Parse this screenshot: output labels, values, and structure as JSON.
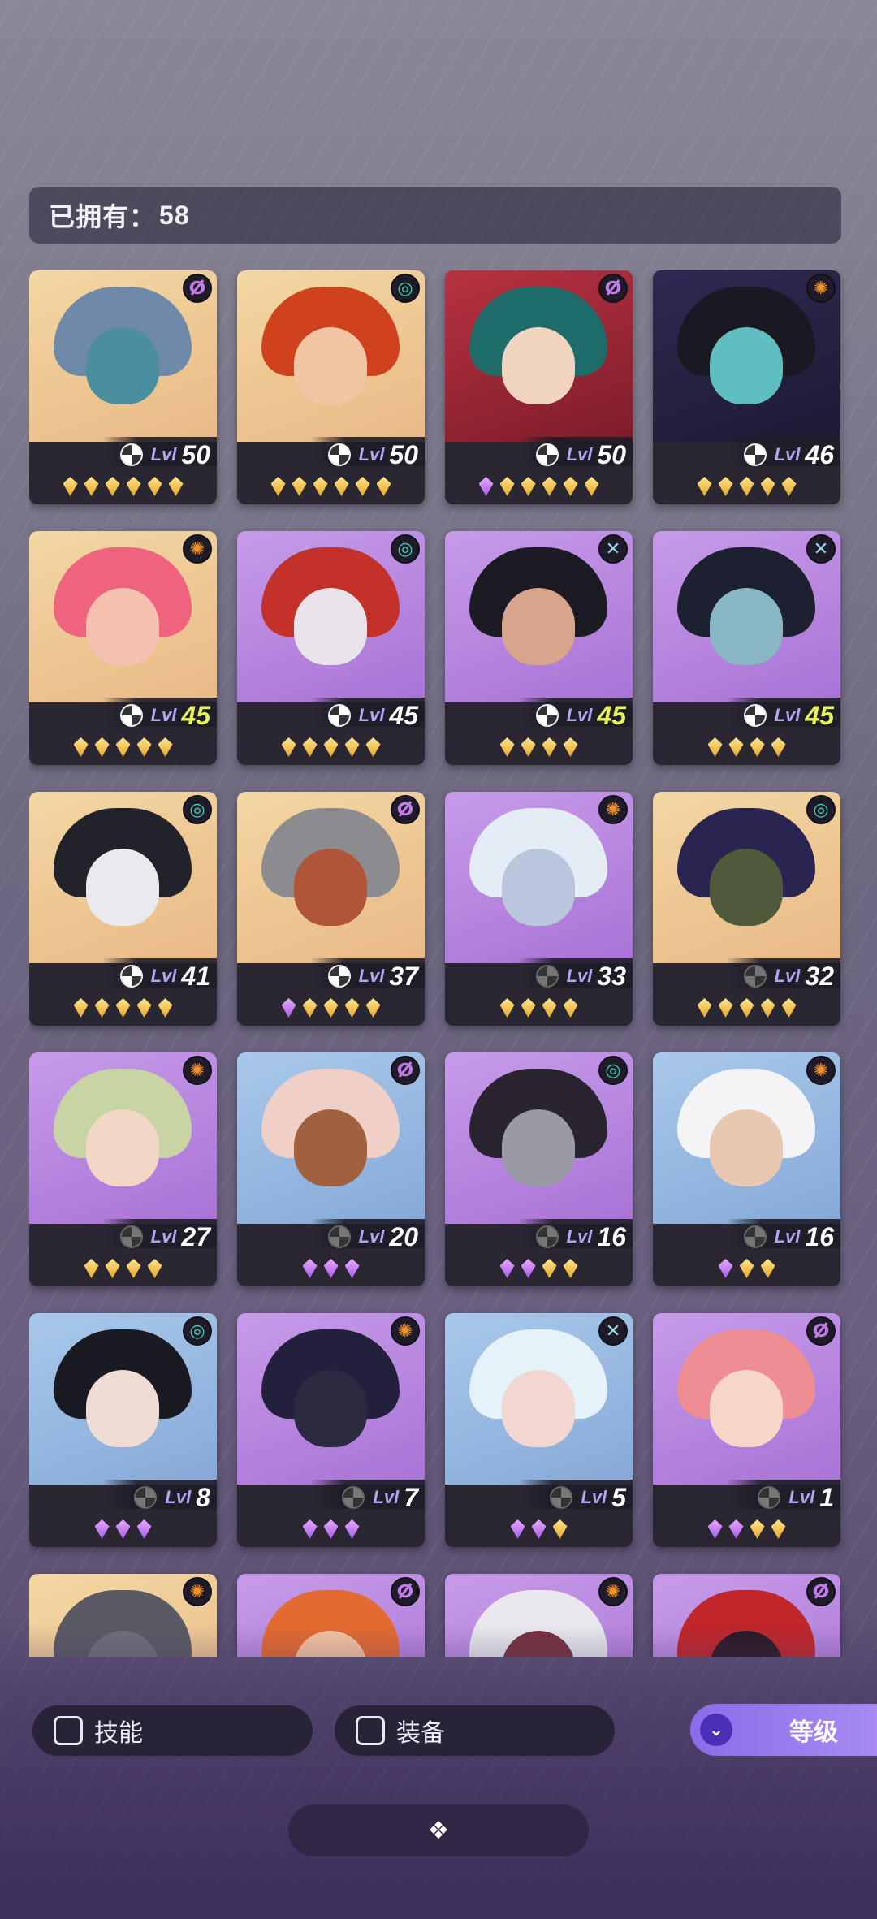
{
  "owned": {
    "label": "已拥有：",
    "count": "58"
  },
  "heroes": [
    {
      "type": "purple-spiral",
      "type_color": "purple",
      "bg": "gold",
      "hair": "#6f8aa8",
      "face": "#4a8ea0",
      "level": "50",
      "level_color": "white",
      "gems": [
        "gold",
        "gold",
        "gold",
        "gold",
        "gold",
        "gold"
      ]
    },
    {
      "type": "green-swirl",
      "type_color": "green",
      "bg": "gold",
      "hair": "#d0421e",
      "face": "#f2c6a4",
      "level": "50",
      "level_color": "white",
      "gems": [
        "gold",
        "gold",
        "gold",
        "gold",
        "gold",
        "gold"
      ]
    },
    {
      "type": "purple-spiral",
      "type_color": "purple",
      "bg": "red",
      "hair": "#1f6d6b",
      "face": "#f0d4c0",
      "level": "50",
      "level_color": "white",
      "gems": [
        "purple",
        "gold",
        "gold",
        "gold",
        "gold",
        "gold"
      ]
    },
    {
      "type": "orange-sun",
      "type_color": "orange",
      "bg": "dark",
      "hair": "#1a1820",
      "face": "#5fbfc0",
      "level": "46",
      "level_color": "white",
      "gems": [
        "gold",
        "gold",
        "gold",
        "gold",
        "gold"
      ]
    },
    {
      "type": "orange-sun",
      "type_color": "orange",
      "bg": "gold",
      "hair": "#f0637e",
      "face": "#f6c2b0",
      "level": "45",
      "level_color": "yellow",
      "gems": [
        "gold",
        "gold",
        "gold",
        "gold",
        "gold"
      ]
    },
    {
      "type": "green-swirl",
      "type_color": "green",
      "bg": "purple",
      "hair": "#c4302a",
      "face": "#e8e4ea",
      "level": "45",
      "level_color": "white",
      "gems": [
        "gold",
        "gold",
        "gold",
        "gold",
        "gold"
      ]
    },
    {
      "type": "teal-cross",
      "type_color": "teal",
      "bg": "purple",
      "hair": "#1c1a22",
      "face": "#d7a58c",
      "level": "45",
      "level_color": "yellow",
      "gems": [
        "gold",
        "gold",
        "gold",
        "gold"
      ]
    },
    {
      "type": "teal-cross",
      "type_color": "teal",
      "bg": "purple",
      "hair": "#1c2030",
      "face": "#8ab7c4",
      "level": "45",
      "level_color": "yellow",
      "gems": [
        "gold",
        "gold",
        "gold",
        "gold"
      ]
    },
    {
      "type": "green-swirl",
      "type_color": "green",
      "bg": "gold",
      "hair": "#22222a",
      "face": "#e9e9ee",
      "level": "41",
      "level_color": "white",
      "gems": [
        "gold",
        "gold",
        "gold",
        "gold",
        "gold"
      ]
    },
    {
      "type": "purple-spiral",
      "type_color": "purple",
      "bg": "gold",
      "hair": "#8c8c90",
      "face": "#b0553a",
      "level": "37",
      "level_color": "white",
      "gems": [
        "purple",
        "gold",
        "gold",
        "gold",
        "gold"
      ]
    },
    {
      "type": "orange-sun",
      "type_color": "orange",
      "bg": "purple",
      "hair": "#e4ecf5",
      "face": "#b9c6dc",
      "level": "33",
      "level_color": "white",
      "gems": [
        "gold",
        "gold",
        "gold",
        "gold"
      ]
    },
    {
      "type": "green-swirl",
      "type_color": "green",
      "bg": "gold",
      "hair": "#2a2450",
      "face": "#4e5a3a",
      "level": "32",
      "level_color": "white",
      "gems": [
        "gold",
        "gold",
        "gold",
        "gold",
        "gold"
      ]
    },
    {
      "type": "orange-sun",
      "type_color": "orange",
      "bg": "purple",
      "hair": "#c8d4a4",
      "face": "#f2d8c4",
      "level": "27",
      "level_color": "white",
      "gems": [
        "gold",
        "gold",
        "gold",
        "gold"
      ]
    },
    {
      "type": "purple-spiral",
      "type_color": "purple",
      "bg": "blue",
      "hair": "#efcfc6",
      "face": "#a0623e",
      "level": "20",
      "level_color": "white",
      "gems": [
        "purple",
        "purple",
        "purple"
      ]
    },
    {
      "type": "green-swirl",
      "type_color": "green",
      "bg": "purple",
      "hair": "#2a2430",
      "face": "#9a9aa4",
      "level": "16",
      "level_color": "white",
      "gems": [
        "purple",
        "purple",
        "gold",
        "gold"
      ]
    },
    {
      "type": "orange-sun",
      "type_color": "orange",
      "bg": "blue",
      "hair": "#f4f4f6",
      "face": "#e8c8b0",
      "level": "16",
      "level_color": "white",
      "gems": [
        "purple",
        "gold",
        "gold"
      ]
    },
    {
      "type": "green-swirl",
      "type_color": "green",
      "bg": "blue",
      "hair": "#1a1a22",
      "face": "#f0dcd4",
      "level": "8",
      "level_color": "white",
      "gems": [
        "purple",
        "purple",
        "purple"
      ]
    },
    {
      "type": "orange-sun",
      "type_color": "orange",
      "bg": "purple",
      "hair": "#22203a",
      "face": "#2c2a40",
      "level": "7",
      "level_color": "white",
      "gems": [
        "purple",
        "purple",
        "purple"
      ]
    },
    {
      "type": "teal-cross",
      "type_color": "teal",
      "bg": "blue",
      "hair": "#e6f2fa",
      "face": "#f2d6d0",
      "level": "5",
      "level_color": "white",
      "gems": [
        "purple",
        "purple",
        "gold"
      ]
    },
    {
      "type": "purple-spiral",
      "type_color": "purple",
      "bg": "purple",
      "hair": "#ee8e92",
      "face": "#f6d6c8",
      "level": "1",
      "level_color": "white",
      "gems": [
        "purple",
        "purple",
        "gold",
        "gold"
      ]
    },
    {
      "type": "orange-sun",
      "type_color": "orange",
      "bg": "gold",
      "hair": "#5a5a64",
      "face": "#6f6f78",
      "level": "",
      "level_color": "white",
      "gems": []
    },
    {
      "type": "purple-spiral",
      "type_color": "purple",
      "bg": "purple",
      "hair": "#e46a30",
      "face": "#f6c6a2",
      "level": "",
      "level_color": "white",
      "gems": []
    },
    {
      "type": "orange-sun",
      "type_color": "orange",
      "bg": "purple",
      "hair": "#e8e8ee",
      "face": "#7a3040",
      "level": "",
      "level_color": "white",
      "gems": []
    },
    {
      "type": "purple-spiral",
      "type_color": "purple",
      "bg": "purple",
      "hair": "#c0262a",
      "face": "#2a1a26",
      "level": "",
      "level_color": "white",
      "gems": []
    }
  ],
  "level_label": "Lvl",
  "filters": {
    "skill_label": "技能",
    "equip_label": "装备"
  },
  "sort": {
    "label": "等级",
    "icon": "double-chevron-down-icon"
  },
  "collapse": {
    "icon": "diamond-cluster-icon",
    "glyph": "❖"
  },
  "colors": {
    "accent": "#9b7cef",
    "gem_gold": "#f2c14a",
    "gem_purple": "#b76ae8",
    "level_highlight": "#e8f25a"
  }
}
